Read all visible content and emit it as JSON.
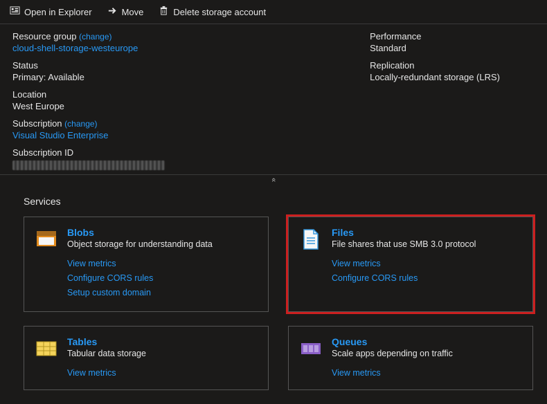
{
  "toolbar": {
    "open_in_explorer": "Open in Explorer",
    "move": "Move",
    "delete": "Delete storage account"
  },
  "props": {
    "resource_group_label": "Resource group",
    "resource_group_change": "(change)",
    "resource_group_value": "cloud-shell-storage-westeurope",
    "status_label": "Status",
    "status_value": "Primary: Available",
    "location_label": "Location",
    "location_value": "West Europe",
    "subscription_label": "Subscription",
    "subscription_change": "(change)",
    "subscription_value": "Visual Studio Enterprise",
    "subscription_id_label": "Subscription ID",
    "performance_label": "Performance",
    "performance_value": "Standard",
    "replication_label": "Replication",
    "replication_value": "Locally-redundant storage (LRS)"
  },
  "collapse_glyph": "«",
  "services_title": "Services",
  "services": {
    "blobs": {
      "title": "Blobs",
      "desc": "Object storage for understanding data",
      "link_metrics": "View metrics",
      "link_cors": "Configure CORS rules",
      "link_custom_domain": "Setup custom domain"
    },
    "files": {
      "title": "Files",
      "desc": "File shares that use SMB 3.0 protocol",
      "link_metrics": "View metrics",
      "link_cors": "Configure CORS rules"
    },
    "tables": {
      "title": "Tables",
      "desc": "Tabular data storage",
      "link_metrics": "View metrics"
    },
    "queues": {
      "title": "Queues",
      "desc": "Scale apps depending on traffic",
      "link_metrics": "View metrics"
    }
  }
}
